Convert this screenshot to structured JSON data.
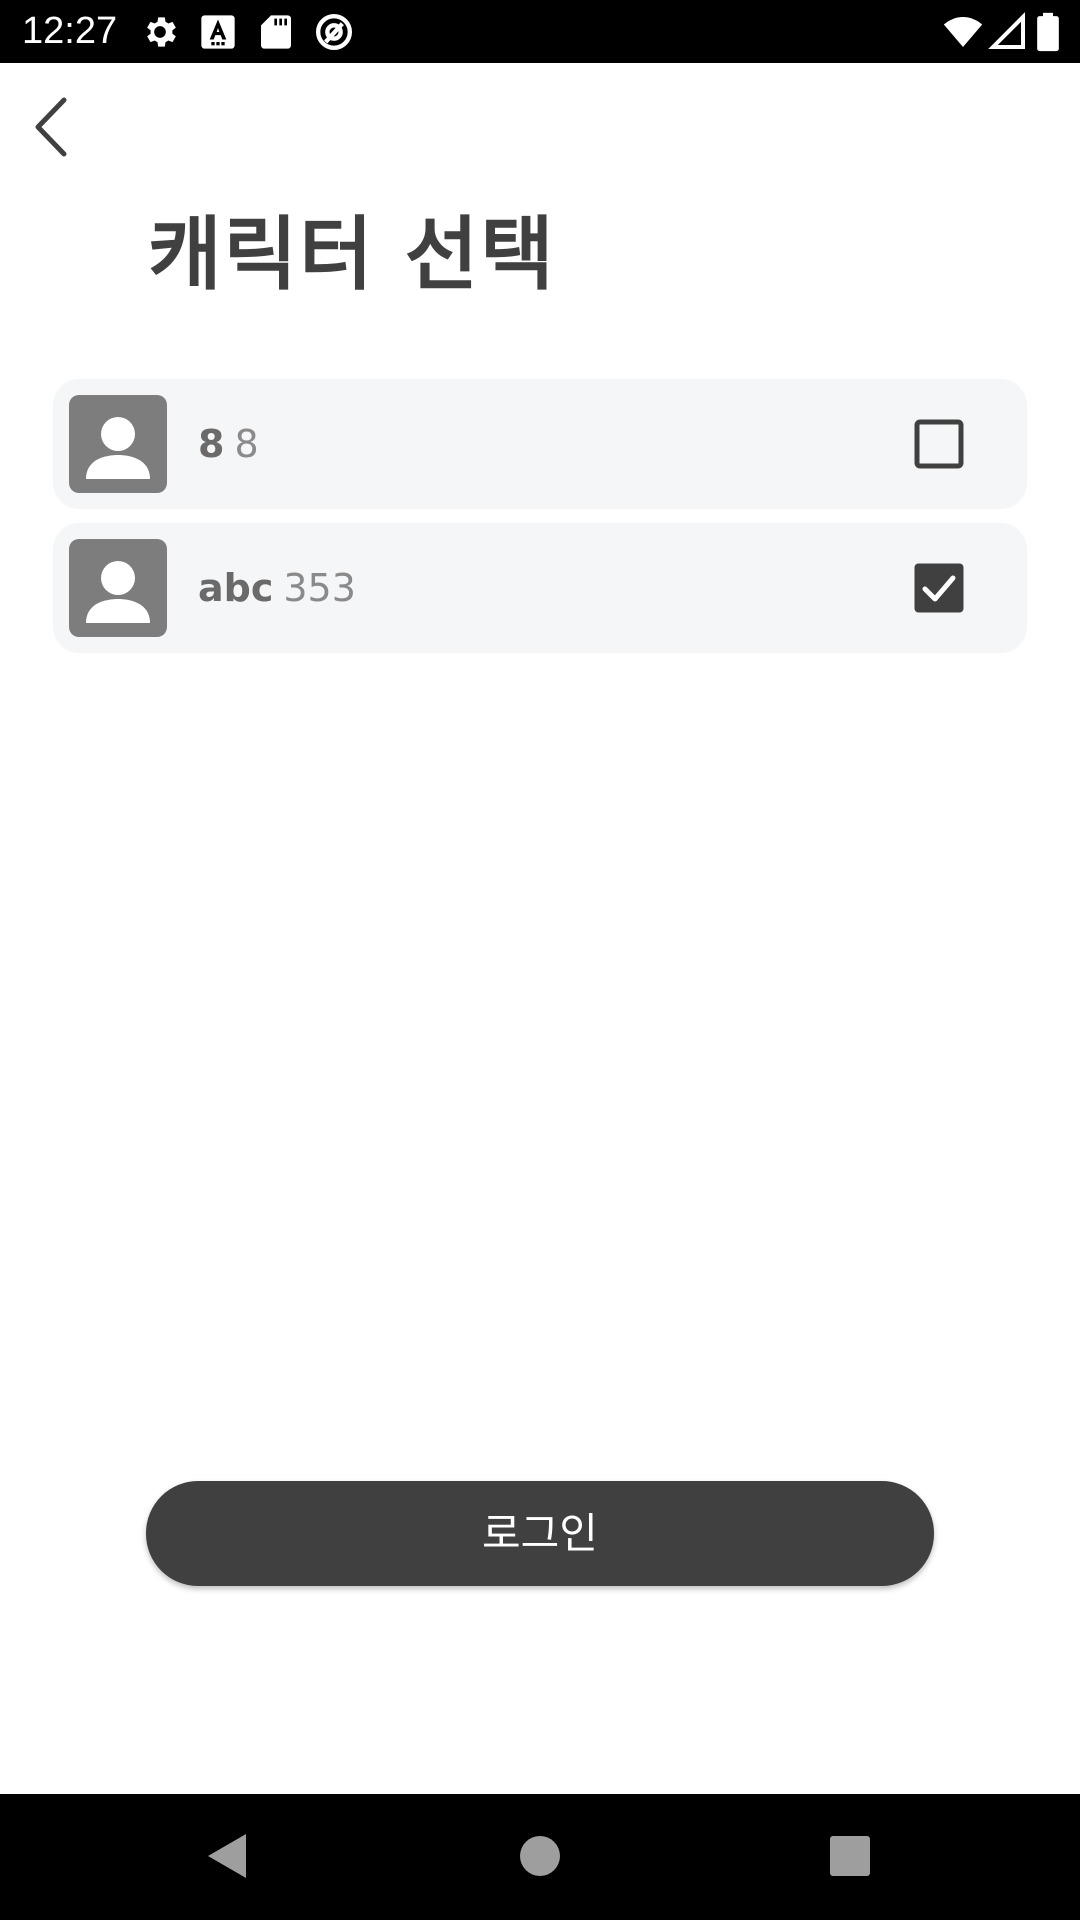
{
  "status_bar": {
    "time": "12:27",
    "left_icons": [
      "settings-icon",
      "text-a-icon",
      "sd-card-icon",
      "at-sign-icon"
    ],
    "right_icons": [
      "wifi-icon",
      "signal-icon",
      "battery-icon"
    ]
  },
  "header": {
    "back_icon": "chevron-left-icon",
    "title": "캐릭터 선택"
  },
  "characters": [
    {
      "name": "8",
      "level": "8",
      "checked": false,
      "avatar_icon": "person-icon"
    },
    {
      "name": "abc",
      "level": "353",
      "checked": true,
      "avatar_icon": "person-icon"
    }
  ],
  "actions": {
    "login_label": "로그인"
  },
  "nav_bar": {
    "icons": [
      "back-triangle-icon",
      "home-circle-icon",
      "recents-square-icon"
    ]
  },
  "colors": {
    "primary": "#404040",
    "card_background": "#f5f6f8",
    "avatar_background": "#7d7d7d"
  }
}
